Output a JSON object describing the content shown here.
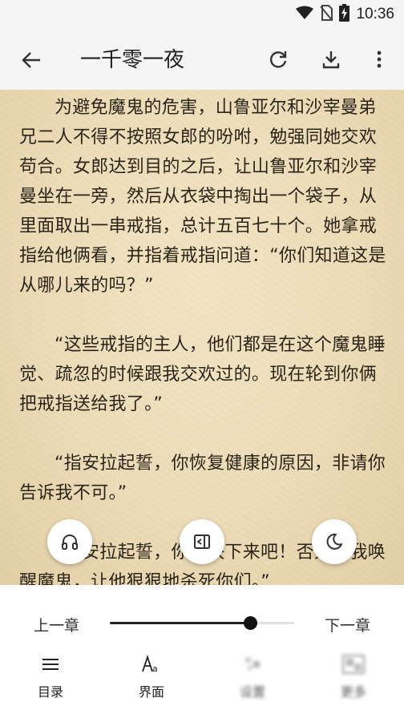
{
  "status": {
    "time": "10:36"
  },
  "appbar": {
    "title": "一千零一夜"
  },
  "content": {
    "paragraphs": [
      "为避免魔鬼的危害，山鲁亚尔和沙宰曼弟兄二人不得不按照女郎的吩咐，勉强同她交欢苟合。女郎达到目的之后，让山鲁亚尔和沙宰曼坐在一旁，然后从衣袋中掏出一个袋子，从里面取出一串戒指，总计五百七十个。她拿戒指给他俩看，并指着戒指问道：“你们知道这是从哪儿来的吗？”",
      "“这些戒指的主人，他们都是在这个魔鬼睡觉、疏忽的时候跟我交欢过的。现在轮到你俩把戒指送给我了。”",
      "“指安拉起誓，你恢复健康的原因，非请你告诉我不可。”",
      "“指安拉起誓，你们快下来吧！否则，我唤醒魔鬼，让他狠狠地杀死你们。”"
    ]
  },
  "controls": {
    "prev_chapter": "上一章",
    "next_chapter": "下一章",
    "progress": 0.76
  },
  "tabs": [
    {
      "label": "目录",
      "icon": "menu-icon"
    },
    {
      "label": "界面",
      "icon": "font-icon"
    },
    {
      "label": "设置",
      "icon": "settings-icon"
    },
    {
      "label": "更多",
      "icon": "more-icon"
    }
  ]
}
